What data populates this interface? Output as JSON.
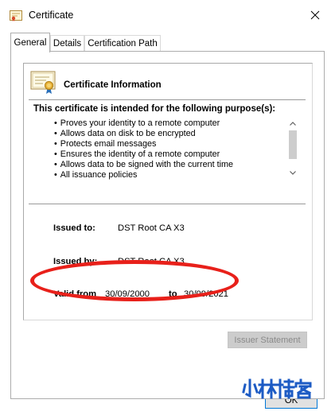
{
  "window": {
    "title": "Certificate",
    "icons": {
      "app": "certificate-icon",
      "close": "close-icon"
    }
  },
  "tabs": [
    {
      "label": "General",
      "active": true
    },
    {
      "label": "Details",
      "active": false
    },
    {
      "label": "Certification Path",
      "active": false
    }
  ],
  "info": {
    "title": "Certificate Information",
    "icon": "certificate-ribbon-icon",
    "purposes_heading": "This certificate is intended for the following purpose(s):",
    "purposes": [
      "Proves your identity to a remote computer",
      "Allows data on disk to be encrypted",
      "Protects email messages",
      "Ensures the identity of a remote computer",
      "Allows data to be signed with the current time",
      "All issuance policies"
    ]
  },
  "details": {
    "issued_to_label": "Issued to:",
    "issued_to_value": "DST Root CA X3",
    "issued_by_label": "Issued by:",
    "issued_by_value": "DST Root CA X3",
    "valid_from_label": "Valid from",
    "valid_from_value": "30/09/2000",
    "valid_to_label": "to",
    "valid_to_value": "30/09/2021"
  },
  "buttons": {
    "issuer_statement": "Issuer Statement",
    "ok": "OK"
  },
  "watermark": {
    "text": "小林博客"
  },
  "colors": {
    "highlight": "#e8201a",
    "ok_border": "#0078d7",
    "watermark": "#1d5bc4",
    "disabled_button": "#cccccc"
  }
}
